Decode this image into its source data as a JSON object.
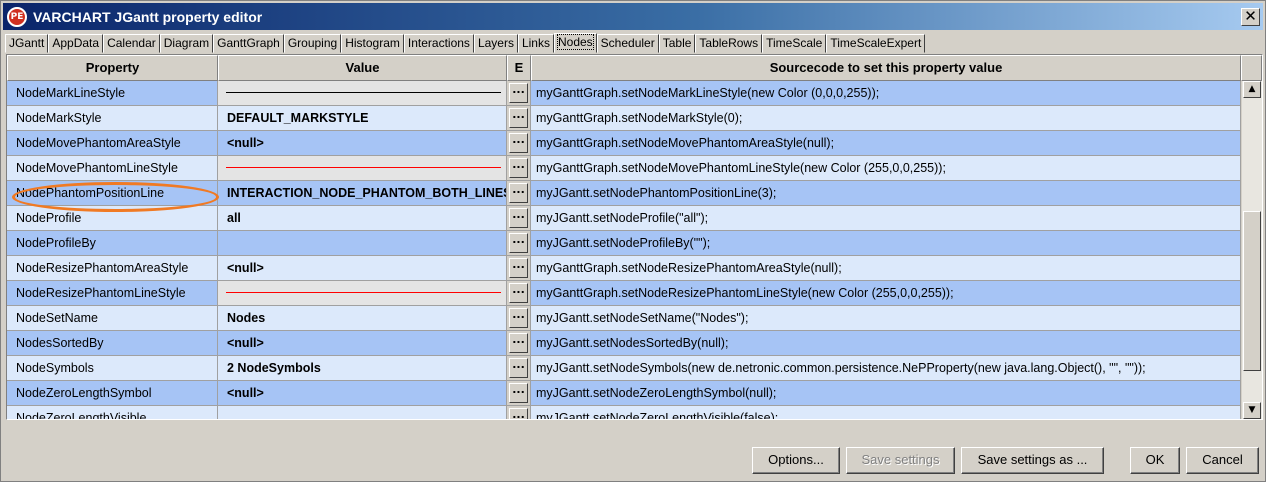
{
  "window": {
    "icon_text": "PE",
    "title": "VARCHART JGantt property editor",
    "close_glyph": "✕"
  },
  "tabs": [
    {
      "label": "JGantt"
    },
    {
      "label": "AppData"
    },
    {
      "label": "Calendar"
    },
    {
      "label": "Diagram"
    },
    {
      "label": "GanttGraph"
    },
    {
      "label": "Grouping"
    },
    {
      "label": "Histogram"
    },
    {
      "label": "Interactions"
    },
    {
      "label": "Layers"
    },
    {
      "label": "Links"
    },
    {
      "label": "Nodes",
      "active": true
    },
    {
      "label": "Scheduler"
    },
    {
      "label": "Table"
    },
    {
      "label": "TableRows"
    },
    {
      "label": "TimeScale"
    },
    {
      "label": "TimeScaleExpert"
    }
  ],
  "table": {
    "headers": {
      "property": "Property",
      "value": "Value",
      "editor": "E",
      "source": "Sourcecode to set this property value"
    },
    "editor_button_label": "...",
    "rows": [
      {
        "property": "NodeMarkLineStyle",
        "value": "",
        "swatch": "#000000",
        "source": "myGanttGraph.setNodeMarkLineStyle(new Color (0,0,0,255));"
      },
      {
        "property": "NodeMarkStyle",
        "value": "DEFAULT_MARKSTYLE",
        "source": "myGanttGraph.setNodeMarkStyle(0);"
      },
      {
        "property": "NodeMovePhantomAreaStyle",
        "value": "<null>",
        "source": "myGanttGraph.setNodeMovePhantomAreaStyle(null);"
      },
      {
        "property": "NodeMovePhantomLineStyle",
        "value": "",
        "swatch": "#ff0000",
        "source": "myGanttGraph.setNodeMovePhantomLineStyle(new Color (255,0,0,255));"
      },
      {
        "property": "NodePhantomPositionLine",
        "value": "INTERACTION_NODE_PHANTOM_BOTH_LINES",
        "source": "myJGantt.setNodePhantomPositionLine(3);",
        "highlighted": true
      },
      {
        "property": "NodeProfile",
        "value": "all",
        "source": "myJGantt.setNodeProfile(\"all\");"
      },
      {
        "property": "NodeProfileBy",
        "value": "",
        "source": "myJGantt.setNodeProfileBy(\"\");"
      },
      {
        "property": "NodeResizePhantomAreaStyle",
        "value": "<null>",
        "source": "myGanttGraph.setNodeResizePhantomAreaStyle(null);"
      },
      {
        "property": "NodeResizePhantomLineStyle",
        "value": "",
        "swatch": "#ff0000",
        "source": "myGanttGraph.setNodeResizePhantomLineStyle(new Color (255,0,0,255));"
      },
      {
        "property": "NodeSetName",
        "value": "Nodes",
        "source": "myJGantt.setNodeSetName(\"Nodes\");"
      },
      {
        "property": "NodesSortedBy",
        "value": "<null>",
        "source": "myJGantt.setNodesSortedBy(null);"
      },
      {
        "property": "NodeSymbols",
        "value": "2  NodeSymbols",
        "source": "myJGantt.setNodeSymbols(new de.netronic.common.persistence.NePProperty(new java.lang.Object(), \"\", \"\"));"
      },
      {
        "property": "NodeZeroLengthSymbol",
        "value": "<null>",
        "source": "myJGantt.setNodeZeroLengthSymbol(null);"
      },
      {
        "property": "NodeZeroLengthVisible",
        "value": "",
        "source": "myJGantt.setNodeZeroLengthVisible(false);"
      }
    ]
  },
  "scrollbar": {
    "up_glyph": "▲",
    "down_glyph": "▼"
  },
  "buttons": {
    "options": "Options...",
    "save_settings": "Save settings",
    "save_settings_as": "Save settings as ...",
    "ok": "OK",
    "cancel": "Cancel"
  },
  "colors": {
    "row_odd": "#a6c4f5",
    "row_even": "#dce9fb",
    "highlight_oval": "#f07a24"
  }
}
